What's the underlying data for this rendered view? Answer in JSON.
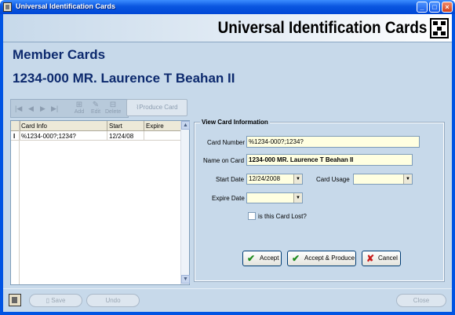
{
  "window": {
    "title": "Universal Identification Cards",
    "controls": {
      "minimize": "_",
      "maximize": "□",
      "close": "×"
    }
  },
  "banner": {
    "title": "Universal Identification Cards",
    "logo_icon": "puzzle-logo-icon"
  },
  "page": {
    "section_title": "Member Cards",
    "member_name": "1234-000 MR. Laurence T Beahan II"
  },
  "toolbar": {
    "nav": {
      "first": "|◀",
      "prev": "◀",
      "next": "▶",
      "last": "▶|"
    },
    "add_label": "Add",
    "edit_label": "Edit",
    "delete_label": "Delete",
    "produce_label": "Produce Card"
  },
  "grid": {
    "columns": [
      "Card Info",
      "Start",
      "Expire"
    ],
    "rows": [
      {
        "indicator": "I",
        "card_info": "%1234-000?;1234?",
        "start": "12/24/08",
        "expire": ""
      }
    ]
  },
  "view_card": {
    "group_title": "View Card Information",
    "card_number_label": "Card Number",
    "card_number_value": "%1234-000?;1234?",
    "name_label": "Name on Card",
    "name_value": "1234-000 MR. Laurence T Beahan II",
    "start_date_label": "Start Date",
    "start_date_value": "12/24/2008",
    "card_usage_label": "Card Usage",
    "card_usage_value": "",
    "expire_date_label": "Expire Date",
    "expire_date_value": "",
    "lost_label": "is this Card Lost?",
    "lost_checked": false,
    "accept_label": "Accept",
    "accept_produce_label": "Accept & Produce",
    "cancel_label": "Cancel"
  },
  "bottom": {
    "save_label": "Save",
    "undo_label": "Undo",
    "close_label": "Close"
  },
  "colors": {
    "titlebar": "#0a56e0",
    "client": "#c7d9ea",
    "heading": "#0d2a6e",
    "field_bg": "#ffffe1"
  }
}
